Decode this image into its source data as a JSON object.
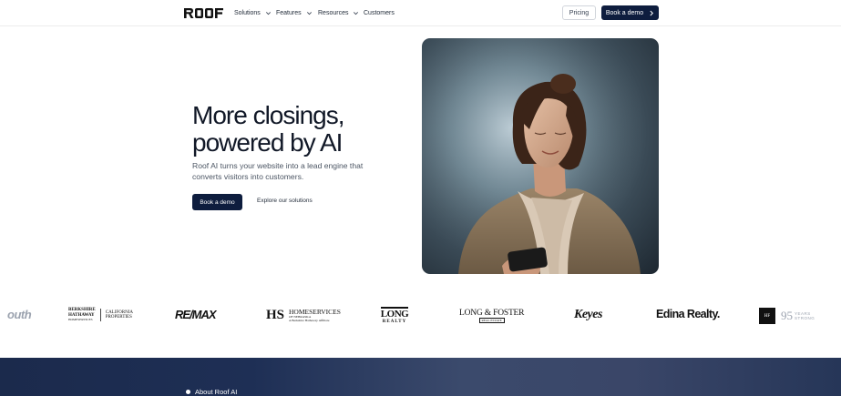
{
  "header": {
    "logo_text": "ROOF",
    "nav": [
      {
        "label": "Solutions",
        "has_dropdown": true
      },
      {
        "label": "Features",
        "has_dropdown": true
      },
      {
        "label": "Resources",
        "has_dropdown": true
      },
      {
        "label": "Customers",
        "has_dropdown": false
      }
    ],
    "pricing_label": "Pricing",
    "demo_label": "Book a demo",
    "demo_icon": "chevron-right-icon"
  },
  "hero": {
    "title_line1": "More closings,",
    "title_line2": "powered by AI",
    "subtitle": "Roof AI turns your website into a lead engine that converts visitors into customers.",
    "primary_cta": "Book a demo",
    "secondary_cta": "Explore our solutions"
  },
  "logos": {
    "items": [
      {
        "name": "south",
        "text": "outh"
      },
      {
        "name": "berkshire-hathaway",
        "lines": [
          "BERKSHIRE",
          "HATHAWAY",
          "HOMESERVICES"
        ],
        "side": [
          "CALIFORNIA",
          "PROPERTIES"
        ]
      },
      {
        "name": "remax",
        "text": "RE/MAX"
      },
      {
        "name": "homeservices-nebraska",
        "mono": "HS",
        "lines": [
          "HOMESERVICES",
          "OF NEBRASKA",
          "A Berkshire Hathaway Affiliate"
        ]
      },
      {
        "name": "long-realty",
        "lines": [
          "LONG",
          "REALTY"
        ]
      },
      {
        "name": "long-foster",
        "lines": [
          "LONG & FOSTER",
          "REAL ESTATE"
        ]
      },
      {
        "name": "keyes",
        "text": "Keyes"
      },
      {
        "name": "edina-realty",
        "text": "Edina Realty."
      },
      {
        "name": "hf",
        "mono": "HF",
        "years": "95",
        "years_lines": [
          "YEARS",
          "STRONG"
        ]
      }
    ]
  },
  "about": {
    "label": "About Roof AI"
  },
  "colors": {
    "primary_button": "#0e1d3e",
    "bottom_band": "#1e2f55"
  }
}
